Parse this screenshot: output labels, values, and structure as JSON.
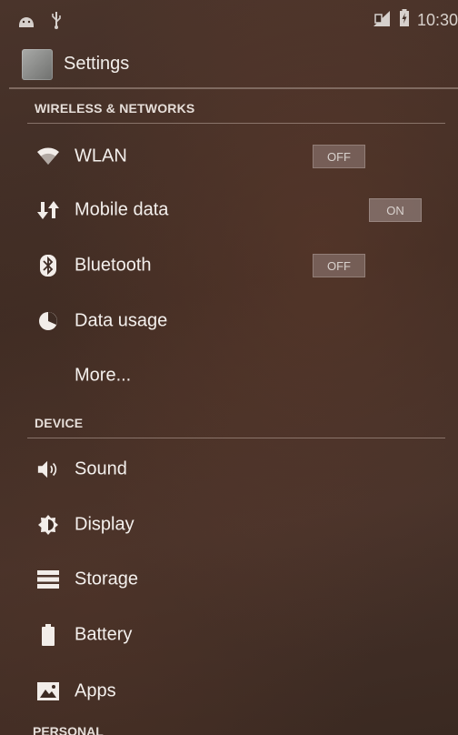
{
  "status_bar": {
    "left_icons": [
      "notification-icon",
      "usb-icon"
    ],
    "right_icons": [
      "sim-signal-icon",
      "battery-charging-icon"
    ],
    "time": "10:30"
  },
  "action_bar": {
    "title": "Settings",
    "icon": "settings-app-icon"
  },
  "sections": {
    "wireless": {
      "header": "WIRELESS & NETWORKS",
      "items": [
        {
          "label": "WLAN",
          "icon": "wifi-icon",
          "toggle": "OFF"
        },
        {
          "label": "Mobile data",
          "icon": "mobile-data-icon",
          "toggle": "ON"
        },
        {
          "label": "Bluetooth",
          "icon": "bluetooth-icon",
          "toggle": "OFF"
        },
        {
          "label": "Data usage",
          "icon": "data-usage-icon"
        },
        {
          "label": "More..."
        }
      ]
    },
    "device": {
      "header": "DEVICE",
      "items": [
        {
          "label": "Sound",
          "icon": "sound-icon"
        },
        {
          "label": "Display",
          "icon": "display-icon"
        },
        {
          "label": "Storage",
          "icon": "storage-icon"
        },
        {
          "label": "Battery",
          "icon": "battery-icon"
        },
        {
          "label": "Apps",
          "icon": "apps-icon"
        }
      ]
    },
    "personal": {
      "header": "PERSONAL"
    }
  }
}
